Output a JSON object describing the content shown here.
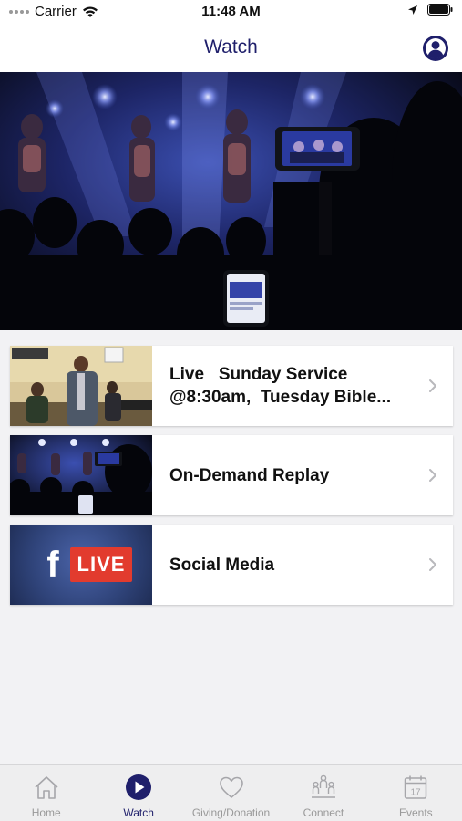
{
  "status_bar": {
    "carrier": "Carrier",
    "time": "11:48 AM"
  },
  "nav": {
    "title": "Watch"
  },
  "items": [
    {
      "label": "Live   Sunday Service @8:30am,  Tuesday Bible..."
    },
    {
      "label": "On-Demand Replay"
    },
    {
      "label": "Social Media",
      "thumb_text": "LIVE",
      "thumb_logo": "f"
    }
  ],
  "tabs": [
    {
      "label": "Home",
      "icon": "home-icon"
    },
    {
      "label": "Watch",
      "icon": "play-icon",
      "active": true
    },
    {
      "label": "Giving/Donation",
      "icon": "heart-icon"
    },
    {
      "label": "Connect",
      "icon": "people-icon"
    },
    {
      "label": "Events",
      "icon": "calendar-icon"
    }
  ],
  "colors": {
    "accent": "#1f1f6b",
    "facebook_blue": "#3b5998",
    "live_red": "#e23b2e"
  }
}
